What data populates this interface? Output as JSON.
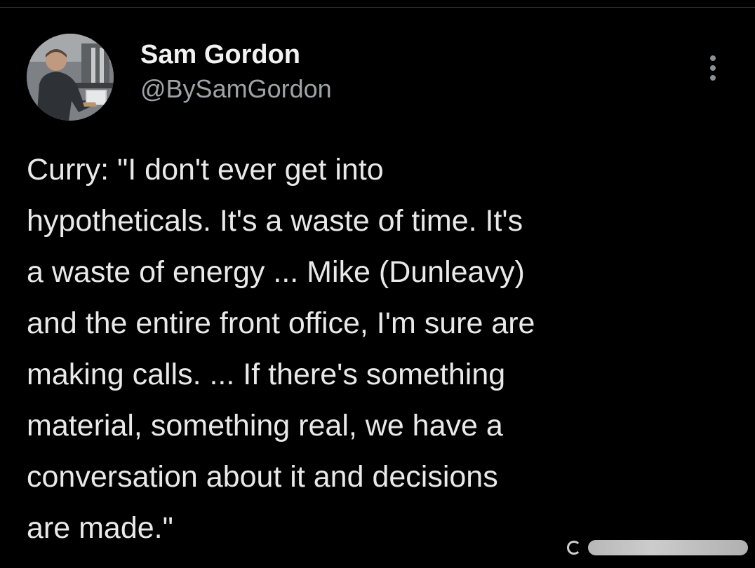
{
  "tweet": {
    "author": {
      "display_name": "Sam Gordon",
      "handle": "@BySamGordon",
      "avatar_icon": "profile-photo"
    },
    "more_icon": "more-vertical-icon",
    "text": "Curry: \"I don't ever get into\nhypotheticals. It's a waste of time. It's\na waste of energy ... Mike (Dunleavy)\nand the entire front office, I'm sure are\nmaking calls. ... If there's something\nmaterial, something real, we have a\nconversation about it and decisions\nare made.\""
  },
  "colors": {
    "background": "#000000",
    "primary_text": "#e7e9ea",
    "secondary_text": "#9ea3a8"
  }
}
